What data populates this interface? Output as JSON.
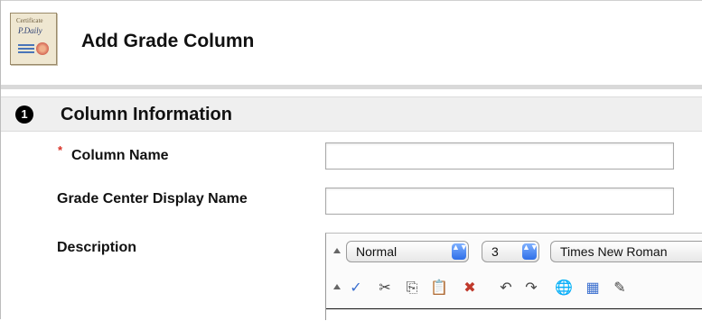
{
  "header": {
    "title": "Add Grade Column",
    "icon_name": "certificate-icon",
    "icon_text_top": "Certificate",
    "icon_text_script": "P.Daily"
  },
  "section": {
    "step_number": "1",
    "title": "Column Information"
  },
  "fields": {
    "column_name": {
      "label": "Column Name",
      "value": "",
      "required": true,
      "required_marker": "*"
    },
    "display_name": {
      "label": "Grade Center Display Name",
      "value": ""
    },
    "description": {
      "label": "Description"
    }
  },
  "editor": {
    "row1": {
      "format_value": "Normal",
      "size_value": "3",
      "font_value": "Times New Roman"
    },
    "row2_icons": [
      "spellcheck-icon",
      "cut-icon",
      "copy-icon",
      "paste-icon",
      "clear-format-icon",
      "undo-icon",
      "redo-icon",
      "link-icon",
      "table-icon",
      "pencil-icon"
    ],
    "glyphs": {
      "spellcheck": "✓",
      "cut": "✂",
      "copy": "⎘",
      "paste": "📋",
      "clear": "✖",
      "undo": "↶",
      "redo": "↷",
      "link": "🌐",
      "table": "▦",
      "pencil": "✎",
      "arrows": "▲▼"
    }
  },
  "colors": {
    "required_star": "#d93025",
    "section_bg": "#efefef",
    "select_arrow": "#2f6fe8"
  }
}
